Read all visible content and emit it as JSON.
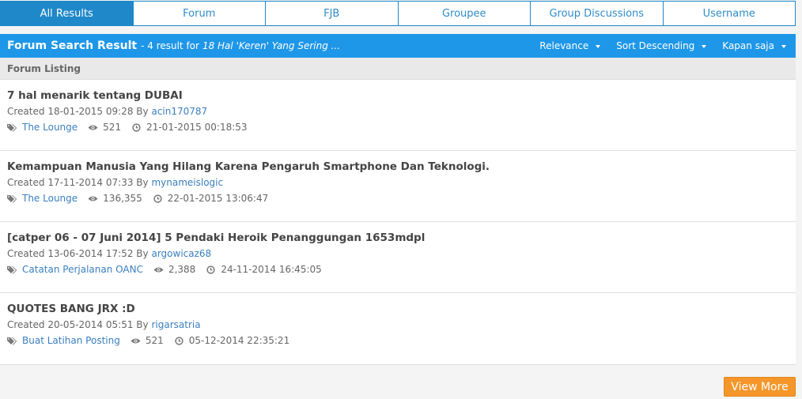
{
  "tabs": [
    {
      "label": "All Results",
      "active": true
    },
    {
      "label": "Forum",
      "active": false
    },
    {
      "label": "FJB",
      "active": false
    },
    {
      "label": "Groupee",
      "active": false
    },
    {
      "label": "Group Discussions",
      "active": false
    },
    {
      "label": "Username",
      "active": false
    }
  ],
  "header": {
    "title": "Forum Search Result",
    "count_text": "- 4 result for",
    "query": "18 Hal 'Keren' Yang Sering ...",
    "filters": [
      {
        "label": "Relevance"
      },
      {
        "label": "Sort Descending"
      },
      {
        "label": "Kapan saja"
      }
    ]
  },
  "section_label": "Forum Listing",
  "created_prefix": "Created",
  "by_text": "By",
  "items": [
    {
      "title": "7 hal menarik tentang DUBAI",
      "created": "18-01-2015 09:28",
      "author": "acin170787",
      "category": "The Lounge",
      "views": "521",
      "last_post": "21-01-2015 00:18:53"
    },
    {
      "title": "Kemampuan Manusia Yang Hilang Karena Pengaruh Smartphone Dan Teknologi.",
      "created": "17-11-2014 07:33",
      "author": "mynameislogic",
      "category": "The Lounge",
      "views": "136,355",
      "last_post": "22-01-2015 13:06:47"
    },
    {
      "title": "[catper 06 - 07 Juni 2014] 5 Pendaki Heroik Penanggungan 1653mdpl",
      "created": "13-06-2014 17:52",
      "author": "argowicaz68",
      "category": "Catatan Perjalanan OANC",
      "views": "2,388",
      "last_post": "24-11-2014 16:45:05"
    },
    {
      "title": "QUOTES BANG JRX :D",
      "created": "20-05-2014 05:51",
      "author": "rigarsatria",
      "category": "Buat Latihan Posting",
      "views": "521",
      "last_post": "05-12-2014 22:35:21"
    }
  ],
  "view_more_label": "View More",
  "colors": {
    "accent": "#1e97e8",
    "tab_border": "#1e88c9",
    "link": "#3a7fbf",
    "button": "#f5962a"
  },
  "icons": [
    "tags-icon",
    "eye-icon",
    "clock-icon",
    "caret-down-icon"
  ]
}
